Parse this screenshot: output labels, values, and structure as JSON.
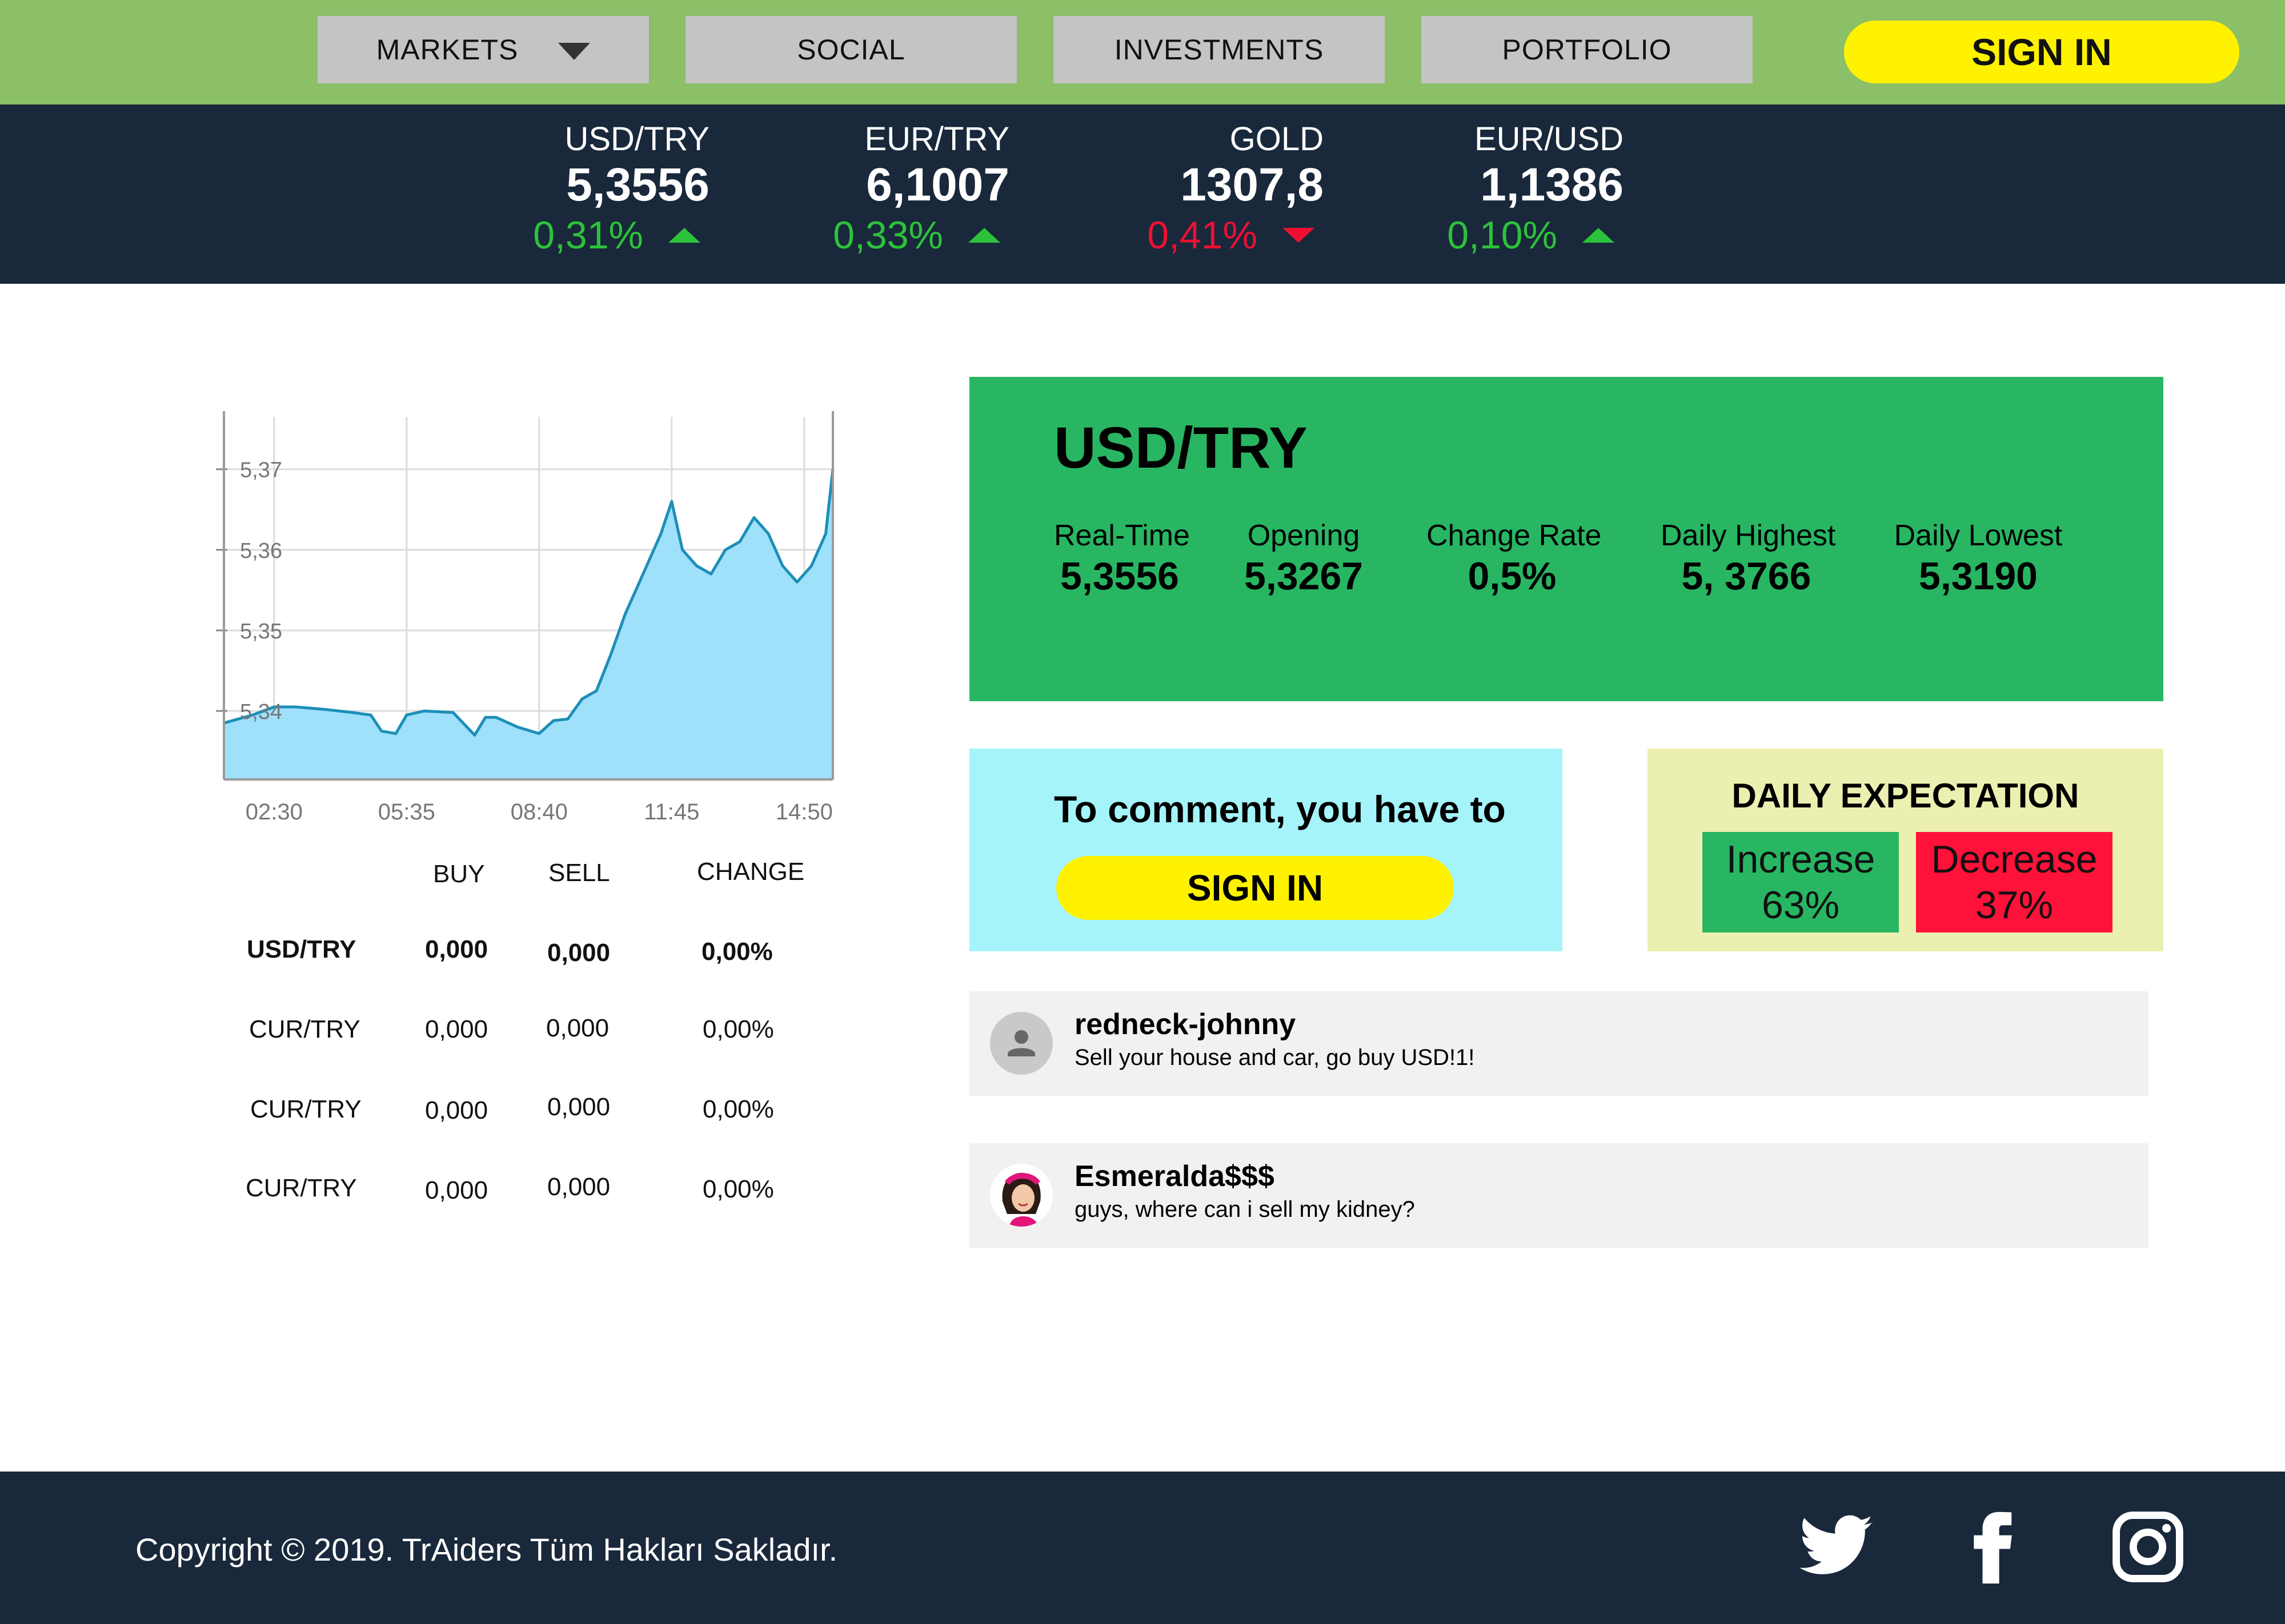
{
  "nav": {
    "items": [
      {
        "label": "MARKETS"
      },
      {
        "label": "SOCIAL"
      },
      {
        "label": "INVESTMENTS"
      },
      {
        "label": "PORTFOLIO"
      }
    ],
    "sign_in": "SIGN IN"
  },
  "ticker": [
    {
      "name": "USD/TRY",
      "value": "5,3556",
      "change": "0,31%",
      "direction": "up"
    },
    {
      "name": "EUR/TRY",
      "value": "6,1007",
      "change": "0,33%",
      "direction": "up"
    },
    {
      "name": "GOLD",
      "value": "1307,8",
      "change": "0,41%",
      "direction": "down"
    },
    {
      "name": "EUR/USD",
      "value": "1,1386",
      "change": "0,10%",
      "direction": "up"
    }
  ],
  "chart_data": {
    "type": "area",
    "x_tick_labels": [
      "02:30",
      "05:35",
      "08:40",
      "11:45",
      "14:50"
    ],
    "y_tick_labels": [
      "5,37",
      "5,36",
      "5,35",
      "5,34"
    ],
    "ylim": [
      5.3315,
      5.3765
    ],
    "x": [
      "01:20",
      "02:00",
      "02:30",
      "03:00",
      "03:40",
      "04:20",
      "04:45",
      "05:00",
      "05:20",
      "05:35",
      "06:00",
      "06:40",
      "07:10",
      "07:25",
      "07:40",
      "08:10",
      "08:40",
      "09:00",
      "09:20",
      "09:40",
      "10:00",
      "10:20",
      "10:40",
      "11:00",
      "11:15",
      "11:30",
      "11:45",
      "12:00",
      "12:20",
      "12:40",
      "13:00",
      "13:20",
      "13:40",
      "14:00",
      "14:20",
      "14:40",
      "15:00",
      "15:20",
      "15:30"
    ],
    "y": [
      5.3385,
      5.3395,
      5.3405,
      5.3405,
      5.3402,
      5.3398,
      5.3395,
      5.3375,
      5.3372,
      5.3395,
      5.34,
      5.3398,
      5.337,
      5.3392,
      5.3392,
      5.338,
      5.3372,
      5.3388,
      5.339,
      5.3415,
      5.3425,
      5.347,
      5.352,
      5.356,
      5.359,
      5.362,
      5.366,
      5.36,
      5.358,
      5.357,
      5.36,
      5.361,
      5.364,
      5.362,
      5.358,
      5.356,
      5.358,
      5.362,
      5.37
    ],
    "grid": true,
    "color": "#1d8fb8",
    "fill": "#9fe0fb"
  },
  "table": {
    "headers": [
      "BUY",
      "SELL",
      "CHANGE"
    ],
    "rows": [
      {
        "pair": "USD/TRY",
        "buy": "0,000",
        "sell": "0,000",
        "change": "0,00%"
      },
      {
        "pair": "CUR/TRY",
        "buy": "0,000",
        "sell": "0,000",
        "change": "0,00%"
      },
      {
        "pair": "CUR/TRY",
        "buy": "0,000",
        "sell": "0,000",
        "change": "0,00%"
      },
      {
        "pair": "CUR/TRY",
        "buy": "0,000",
        "sell": "0,000",
        "change": "0,00%"
      }
    ]
  },
  "summary": {
    "title": "USD/TRY",
    "stats": [
      {
        "label": "Real-Time",
        "value": "5,3556"
      },
      {
        "label": "Opening",
        "value": "5,3267"
      },
      {
        "label": "Change Rate",
        "value": "0,5%"
      },
      {
        "label": "Daily Highest",
        "value": "5, 3766"
      },
      {
        "label": "Daily Lowest",
        "value": "5,3190"
      }
    ]
  },
  "comment_prompt": {
    "text": "To comment, you have to",
    "button": "SIGN IN"
  },
  "expectation": {
    "title": "DAILY EXPECTATION",
    "increase_label": "Increase",
    "increase_value": "63%",
    "decrease_label": "Decrease",
    "decrease_value": "37%"
  },
  "comments": [
    {
      "user": "redneck-johnny",
      "text": "Sell your house and car, go buy USD!1!"
    },
    {
      "user": "Esmeralda$$$",
      "text": "guys, where can i sell my kidney?"
    }
  ],
  "footer": {
    "copyright": "Copyright © 2019. TrAiders Tüm Hakları Sakladır."
  },
  "colors": {
    "nav_bg": "#8bbf68",
    "dark_bg": "#19283b",
    "accent_yellow": "#fff200",
    "summary_green": "#28b663",
    "up_green": "#2dc23b",
    "down_red": "#ee0f33"
  }
}
